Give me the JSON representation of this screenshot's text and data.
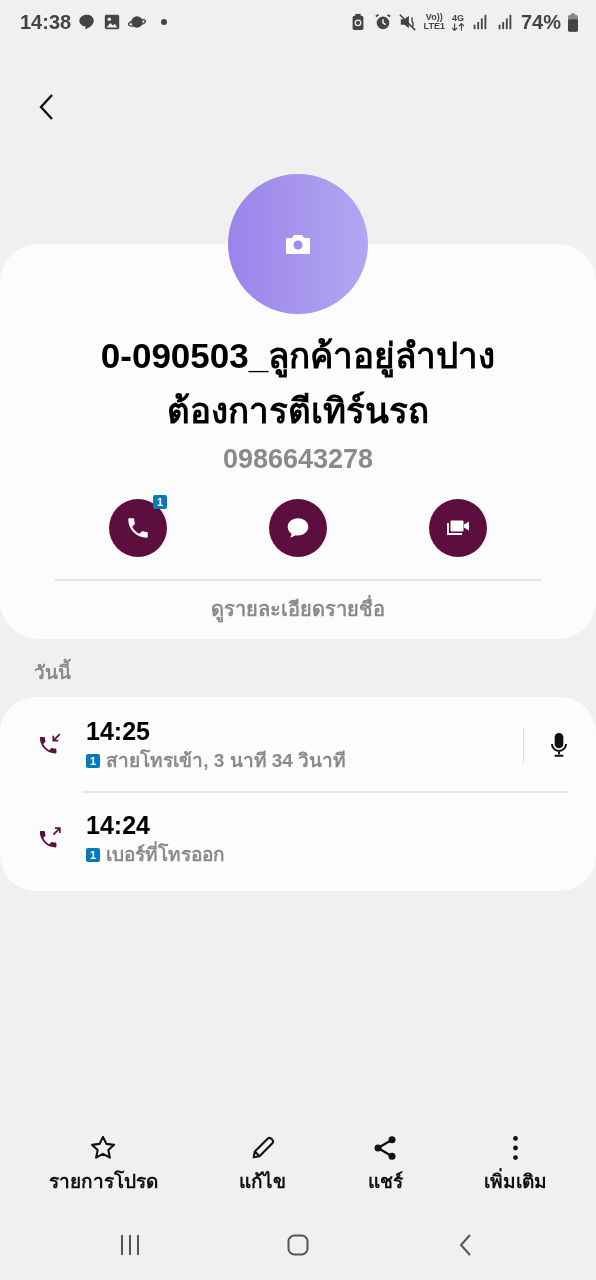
{
  "status_bar": {
    "time": "14:38",
    "volte": "Vo))",
    "volte_sub": "LTE1",
    "network": "4G",
    "battery": "74%"
  },
  "contact": {
    "name_lines": [
      "0-090503_ลูกค้าอยู่ลำปาง",
      "ต้องการตีเทิร์นรถ"
    ],
    "number": "0986643278",
    "actions": [
      {
        "kind": "call",
        "sim_badge": "1"
      },
      {
        "kind": "message"
      },
      {
        "kind": "video"
      }
    ],
    "details_link": "ดูรายละเอียดรายชื่อ"
  },
  "history": {
    "section": "วันนี้",
    "calls": [
      {
        "kind": "incoming",
        "time": "14:25",
        "sim": "1",
        "description": "สายโทรเข้า, 3 นาที 34 วินาที",
        "recording": true
      },
      {
        "kind": "outgoing",
        "time": "14:24",
        "sim": "1",
        "description": "เบอร์ที่โทรออก",
        "recording": false
      }
    ]
  },
  "bottom_actions": [
    {
      "kind": "favorite",
      "label": "รายการโปรด"
    },
    {
      "kind": "edit",
      "label": "แก้ไข"
    },
    {
      "kind": "share",
      "label": "แชร์"
    },
    {
      "kind": "more",
      "label": "เพิ่มเติม"
    }
  ]
}
